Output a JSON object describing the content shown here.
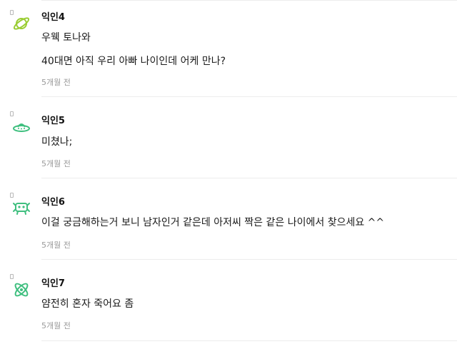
{
  "comments": [
    {
      "author": "익인4",
      "avatar_icon": "planet-icon",
      "lines": [
        "우웩 토나와",
        "40대면 아직 우리 아빠 나이인데 어케 만나?"
      ],
      "time": "5개월 전"
    },
    {
      "author": "익인5",
      "avatar_icon": "ufo-icon",
      "lines": [
        "미쳤나;"
      ],
      "time": "5개월 전"
    },
    {
      "author": "익인6",
      "avatar_icon": "space-invader-icon",
      "lines": [
        "이걸 궁금해하는거 보니 남자인거 같은데 아저씨 짝은 같은 나이에서 찾으세요 ^^"
      ],
      "time": "5개월 전"
    },
    {
      "author": "익인7",
      "avatar_icon": "atom-icon",
      "lines": [
        "얌전히 혼자 죽어요 좀"
      ],
      "time": "5개월 전"
    }
  ],
  "colors": {
    "avatar_green": "#3fbf7f",
    "time_gray": "#9a9a9a",
    "divider": "#ececec"
  }
}
